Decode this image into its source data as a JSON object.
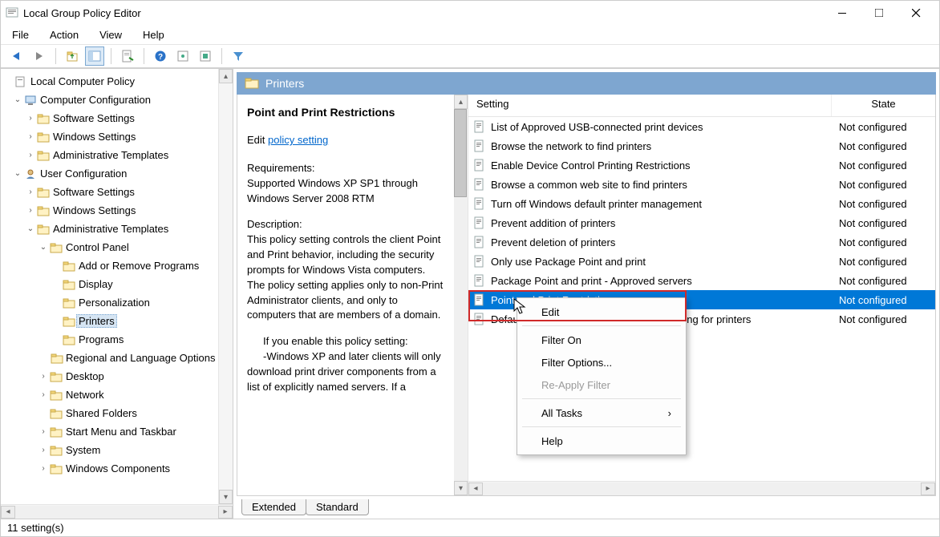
{
  "window": {
    "title": "Local Group Policy Editor"
  },
  "menu": {
    "file": "File",
    "action": "Action",
    "view": "View",
    "help": "Help"
  },
  "tree": {
    "root": "Local Computer Policy",
    "computer_cfg": "Computer Configuration",
    "cc_software": "Software Settings",
    "cc_windows": "Windows Settings",
    "cc_admin": "Administrative Templates",
    "user_cfg": "User Configuration",
    "uc_software": "Software Settings",
    "uc_windows": "Windows Settings",
    "uc_admin": "Administrative Templates",
    "control_panel": "Control Panel",
    "cp_addremove": "Add or Remove Programs",
    "cp_display": "Display",
    "cp_personalization": "Personalization",
    "cp_printers": "Printers",
    "cp_programs": "Programs",
    "cp_regional": "Regional and Language Options",
    "desktop": "Desktop",
    "network": "Network",
    "shared_folders": "Shared Folders",
    "startmenu": "Start Menu and Taskbar",
    "system": "System",
    "windows_components": "Windows Components"
  },
  "rp": {
    "header": "Printers",
    "setting_name": "Point and Print Restrictions",
    "edit_label": "Edit",
    "policy_link": "policy setting",
    "req_h": "Requirements:",
    "req_body": "Supported Windows XP SP1 through Windows Server 2008 RTM",
    "desc_h": "Description:",
    "desc_body1": "This policy setting controls the client Point and Print behavior, including the security prompts for Windows Vista computers. The policy setting applies only to non-Print Administrator clients, and only to computers that are members of a domain.",
    "desc_body2": "If you enable this policy setting:",
    "desc_body3": "-Windows XP and later clients will only download print driver components from a list of explicitly named servers. If a"
  },
  "columns": {
    "setting": "Setting",
    "state": "State"
  },
  "state_nc": "Not configured",
  "settings": [
    {
      "name": "List of Approved USB-connected print devices"
    },
    {
      "name": "Browse the network to find printers"
    },
    {
      "name": "Enable Device Control Printing Restrictions"
    },
    {
      "name": "Browse a common web site to find printers"
    },
    {
      "name": "Turn off Windows default printer management"
    },
    {
      "name": "Prevent addition of printers"
    },
    {
      "name": "Prevent deletion of printers"
    },
    {
      "name": "Only use Package Point and print"
    },
    {
      "name": "Package Point and print - Approved servers"
    },
    {
      "name": "Point and Print Restrictions",
      "_sel": true
    },
    {
      "name": "Default Active Directory path when searching for printers"
    }
  ],
  "ctx": {
    "edit": "Edit",
    "filter_on": "Filter On",
    "filter_opts": "Filter Options...",
    "reapply": "Re-Apply Filter",
    "all_tasks": "All Tasks",
    "help": "Help"
  },
  "tabs": {
    "extended": "Extended",
    "standard": "Standard"
  },
  "status": "11 setting(s)"
}
